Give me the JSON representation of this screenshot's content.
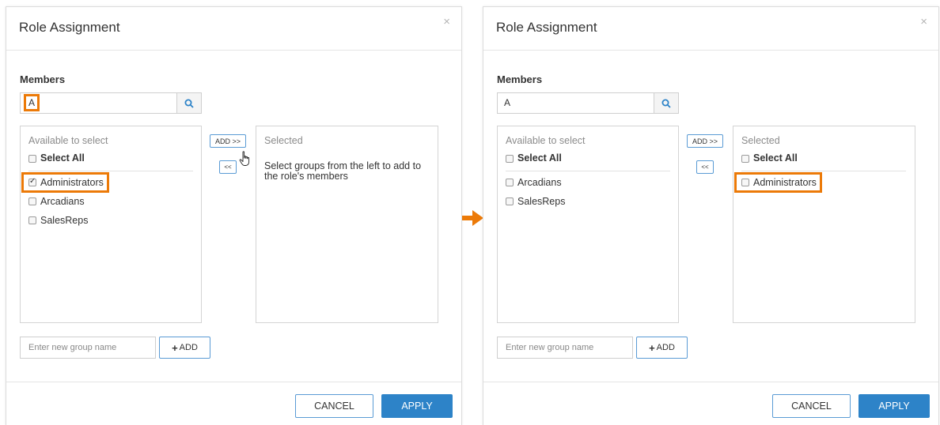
{
  "dialog_before": {
    "title": "Role Assignment",
    "close": "×",
    "members_label": "Members",
    "search_value": "A",
    "available_header": "Available to select",
    "select_all": "Select All",
    "available_items": [
      {
        "label": "Administrators",
        "checked": true
      },
      {
        "label": "Arcadians",
        "checked": false
      },
      {
        "label": "SalesReps",
        "checked": false
      }
    ],
    "add_button": "ADD >>",
    "remove_button": "<<",
    "selected_header": "Selected",
    "selected_helper": "Select groups from the left to add to the role's members",
    "new_group_placeholder": "Enter new group name",
    "plus_add": "ADD",
    "cancel": "CANCEL",
    "apply": "APPLY"
  },
  "dialog_after": {
    "title": "Role Assignment",
    "close": "×",
    "members_label": "Members",
    "search_value": "A",
    "available_header": "Available to select",
    "select_all": "Select All",
    "available_items": [
      {
        "label": "Arcadians",
        "checked": false
      },
      {
        "label": "SalesReps",
        "checked": false
      }
    ],
    "add_button": "ADD >>",
    "remove_button": "<<",
    "selected_header": "Selected",
    "selected_select_all": "Select All",
    "selected_items": [
      {
        "label": "Administrators",
        "checked": false
      }
    ],
    "new_group_placeholder": "Enter new group name",
    "plus_add": "ADD",
    "cancel": "CANCEL",
    "apply": "APPLY"
  },
  "colors": {
    "highlight": "#ec7a08",
    "primary": "#2d83c8",
    "border_accent": "#5a9bd5"
  },
  "icons": {
    "search": "search-icon",
    "transition": "arrow-right-icon",
    "pointer": "hand-pointer-icon"
  }
}
